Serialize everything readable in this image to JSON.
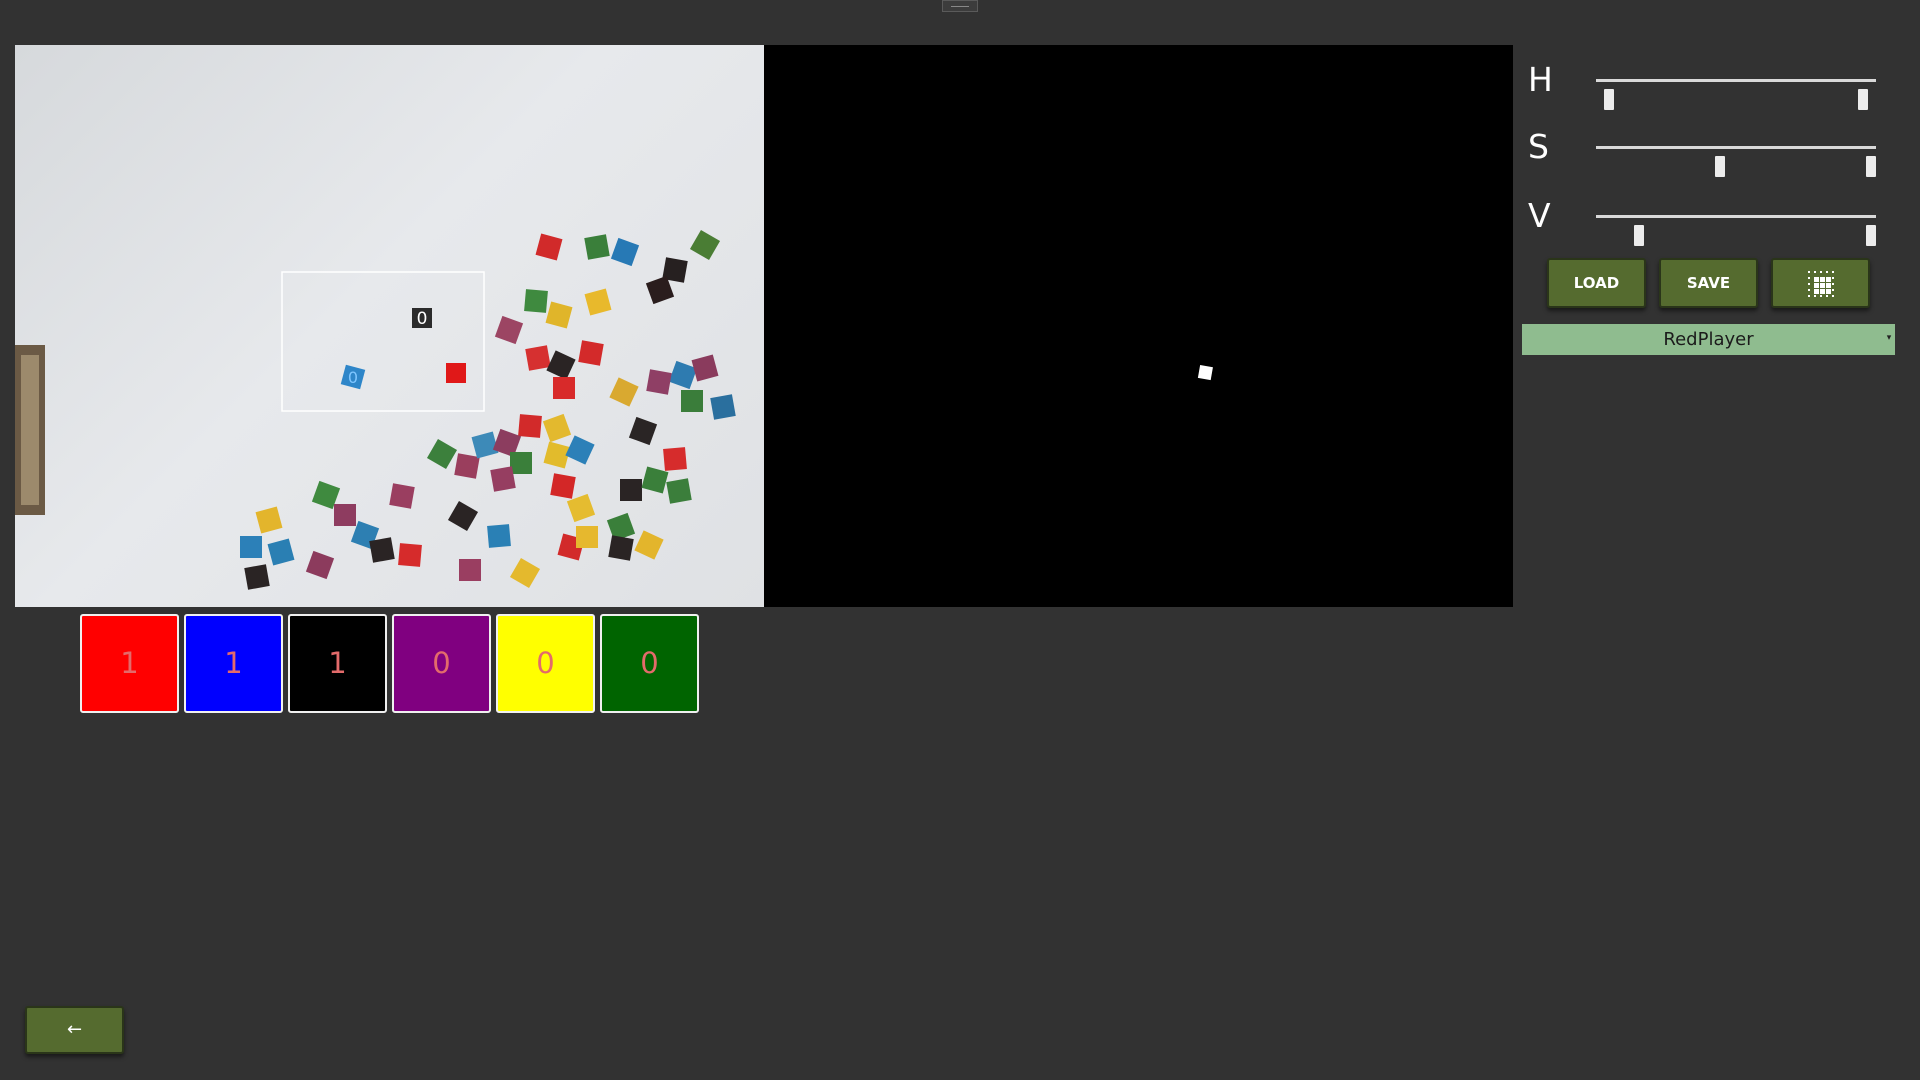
{
  "sliders": [
    {
      "label": "H",
      "low": 0.03,
      "high": 0.97
    },
    {
      "label": "S",
      "low": 0.44,
      "high": 1.0
    },
    {
      "label": "V",
      "low": 0.14,
      "high": 1.0
    }
  ],
  "buttons": {
    "load_label": "LOAD",
    "save_label": "SAVE",
    "grid_icon": "grid-icon"
  },
  "player_select": {
    "value": "RedPlayer"
  },
  "color_counters": [
    {
      "color": "#ff0000",
      "count": "1"
    },
    {
      "color": "#0000ff",
      "count": "1"
    },
    {
      "color": "#000000",
      "count": "1"
    },
    {
      "color": "#800080",
      "count": "0"
    },
    {
      "color": "#ffff00",
      "count": "0"
    },
    {
      "color": "#006400",
      "count": "0"
    }
  ],
  "back_button": {
    "label": "←"
  },
  "camera_view": {
    "detected_markers": [
      "0",
      "0"
    ]
  },
  "icons": [
    "menu-handle-icon",
    "grid-icon",
    "dropdown-caret-icon",
    "back-arrow-icon"
  ]
}
